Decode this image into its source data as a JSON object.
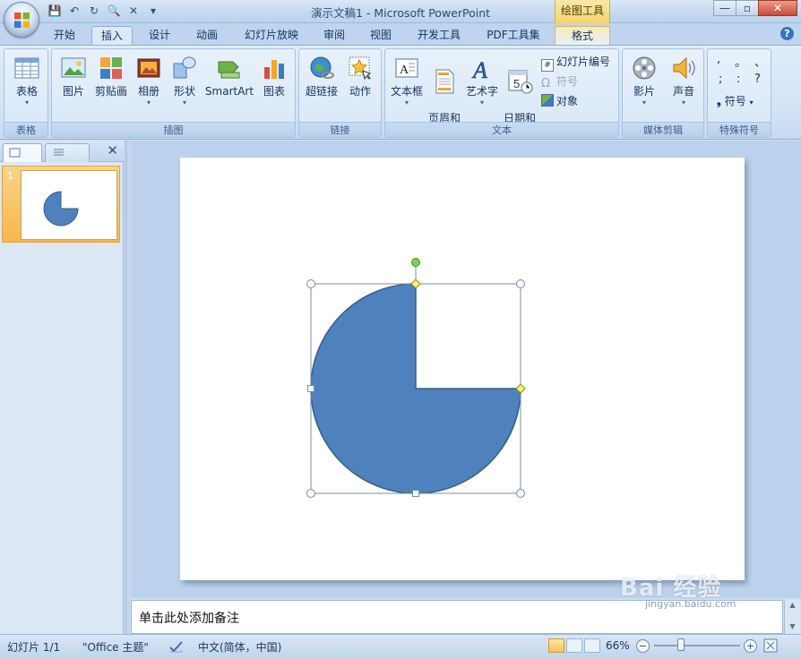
{
  "window": {
    "title": "演示文稿1 - Microsoft PowerPoint",
    "context_tab_title": "绘图工具",
    "minimize": "—",
    "maximize": "▫",
    "close": "✕"
  },
  "qat": [
    "💾",
    "↶",
    "↻",
    "🔍",
    "✕",
    "▾"
  ],
  "tabs": [
    "开始",
    "插入",
    "设计",
    "动画",
    "幻灯片放映",
    "审阅",
    "视图",
    "开发工具",
    "PDF工具集",
    "格式"
  ],
  "active_tab": "插入",
  "ribbon": {
    "groups": {
      "table": {
        "label": "表格",
        "buttons": [
          "表格"
        ]
      },
      "illustrations": {
        "label": "插图",
        "buttons": [
          "图片",
          "剪贴画",
          "相册",
          "形状",
          "SmartArt",
          "图表"
        ]
      },
      "links": {
        "label": "链接",
        "buttons": [
          "超链接",
          "动作"
        ]
      },
      "text": {
        "label": "文本",
        "buttons": [
          "文本框",
          "页眉和\n页脚",
          "艺术字",
          "日期和\n时间"
        ],
        "small": [
          "幻灯片编号",
          "符号",
          "对象"
        ]
      },
      "media": {
        "label": "媒体剪辑",
        "buttons": [
          "影片",
          "声音"
        ]
      },
      "special": {
        "label": "特殊符号",
        "symbols": [
          ",",
          "。",
          "、",
          ";",
          ":",
          "?"
        ],
        "symbol_button": "符号"
      }
    }
  },
  "pane": {
    "close": "✕",
    "thumb_number": "1"
  },
  "notes_placeholder": "单击此处添加备注",
  "status": {
    "slide_info": "幻灯片 1/1",
    "theme": "\"Office 主题\"",
    "language": "中文(简体，中国)",
    "zoom": "66%"
  },
  "colors": {
    "shape_fill": "#4f81bd",
    "shape_stroke": "#385d8a",
    "selection": "#7f8ea2"
  },
  "watermark": {
    "text": "Bai 经验",
    "sub": "jingyan.baidu.com"
  }
}
